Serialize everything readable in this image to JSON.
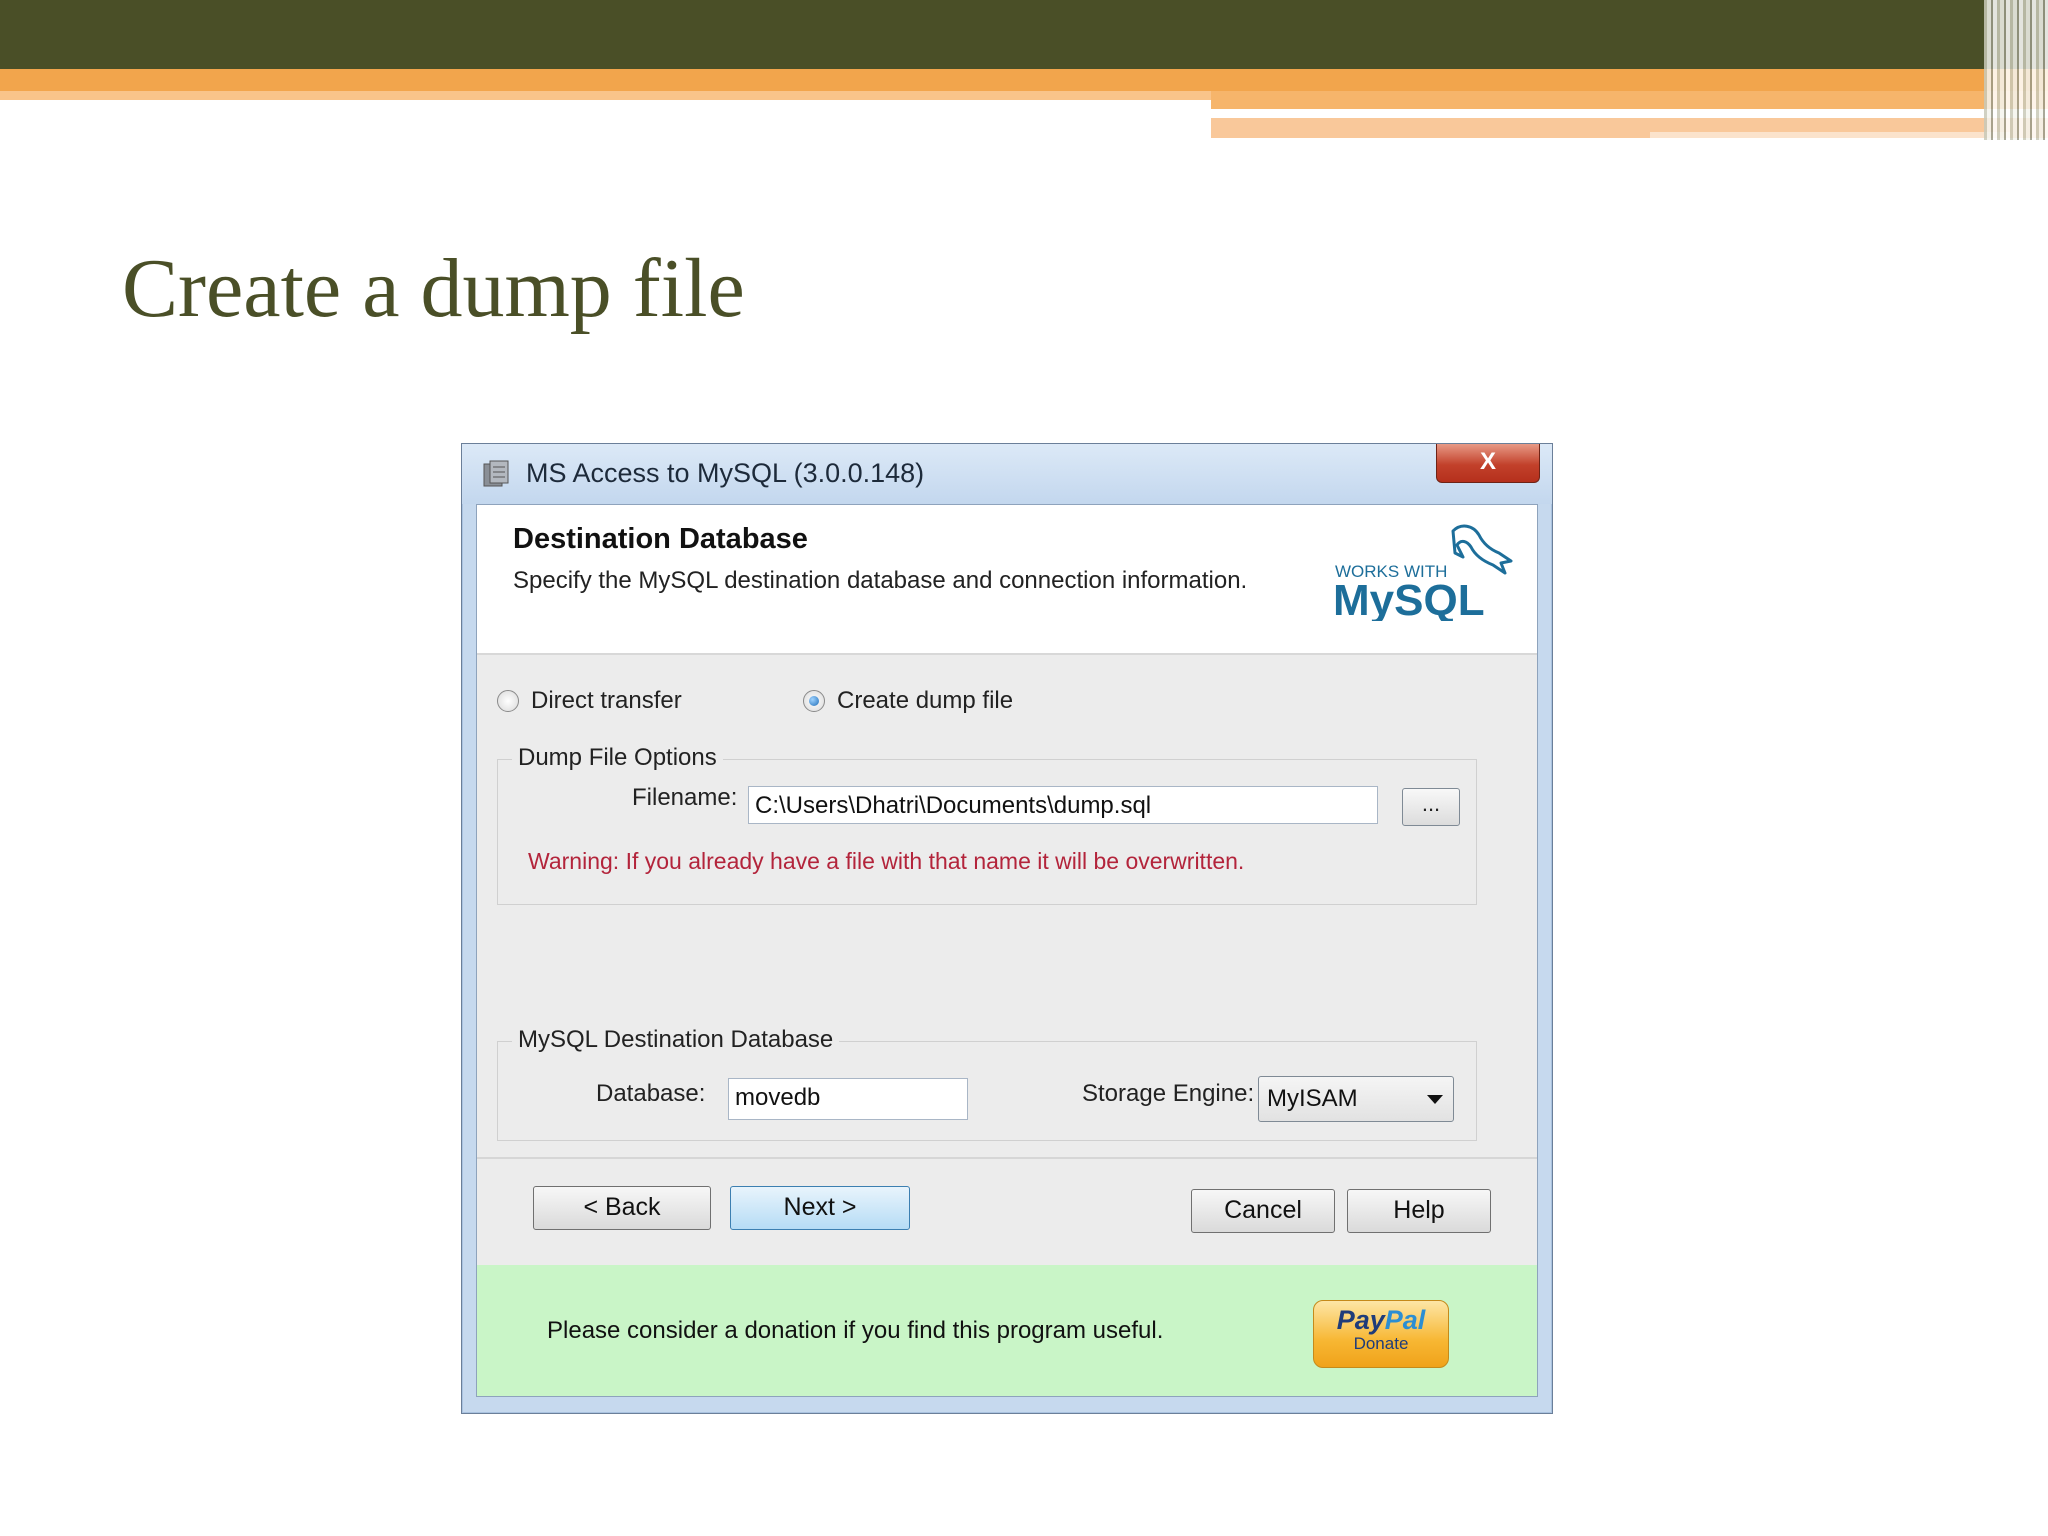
{
  "slide": {
    "title": "Create a dump file"
  },
  "window": {
    "title": "MS Access to MySQL (3.0.0.148)",
    "close_label": "X"
  },
  "header": {
    "title": "Destination Database",
    "subtitle": "Specify the MySQL destination database and connection information.",
    "logo_top": "WORKS WITH",
    "logo_main": "MySQL"
  },
  "transfer_mode": {
    "options": [
      {
        "label": "Direct transfer",
        "checked": false
      },
      {
        "label": "Create dump file",
        "checked": true
      }
    ]
  },
  "dump_options": {
    "group_label": "Dump File Options",
    "filename_label": "Filename:",
    "filename_value": "C:\\Users\\Dhatri\\Documents\\dump.sql",
    "browse_label": "...",
    "warning": "Warning: If you already have a file with that name it will be overwritten."
  },
  "destination": {
    "group_label": "MySQL Destination Database",
    "database_label": "Database:",
    "database_value": "movedb",
    "engine_label": "Storage Engine:",
    "engine_value": "MyISAM"
  },
  "buttons": {
    "back": "< Back",
    "next": "Next >",
    "cancel": "Cancel",
    "help": "Help"
  },
  "footer": {
    "text": "Please consider a donation if you find this program useful.",
    "paypal_pay": "Pay",
    "paypal_pal": "Pal",
    "paypal_donate": "Donate"
  },
  "colors": {
    "slide_dark": "#4a4f27",
    "slide_orange": "#f2a54c",
    "warning_red": "#b3243b",
    "footer_green": "#c9f5c7"
  }
}
